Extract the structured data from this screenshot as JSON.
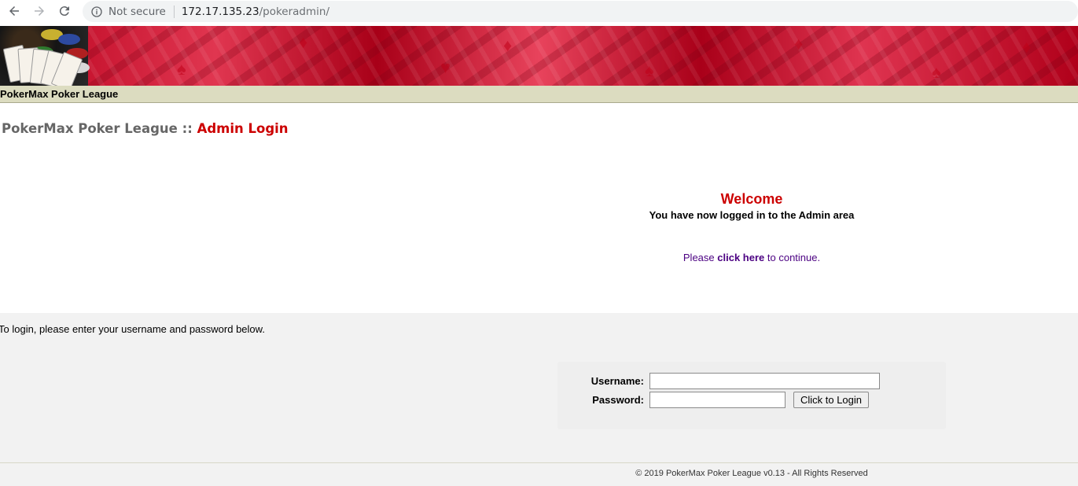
{
  "browser": {
    "security_label": "Not secure",
    "url_host": "172.17.135.23",
    "url_path": "/pokeradmin/"
  },
  "titlebar": {
    "text": "PokerMax Poker League"
  },
  "heading": {
    "site": "PokerMax Poker League",
    "separator": "::",
    "section": "Admin Login"
  },
  "welcome": {
    "title": "Welcome",
    "subtitle": "You have now logged in to the Admin area",
    "continue_prefix": "Please",
    "continue_link": "click here",
    "continue_suffix": "to continue."
  },
  "login": {
    "intro": "To login, please enter your username and password below.",
    "username_label": "Username:",
    "password_label": "Password:",
    "username_value": "",
    "password_value": "",
    "button_label": "Click to Login"
  },
  "footer": {
    "text": "© 2019 PokerMax Poker League v0.13 - All Rights Reserved"
  },
  "colors": {
    "accent": "#cc0000",
    "link": "#4b0082",
    "titlebar_bg": "#dcdcc0",
    "login_bg": "#f2f2f2"
  },
  "icons": [
    "back-arrow-icon",
    "forward-arrow-icon",
    "reload-icon",
    "info-icon"
  ]
}
